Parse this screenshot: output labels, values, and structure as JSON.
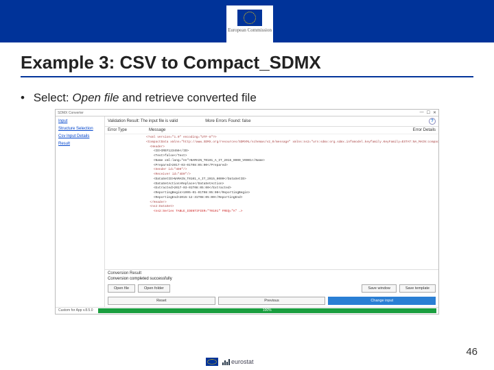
{
  "slide": {
    "title": "Example 3: CSV to Compact_SDMX",
    "bullet_prefix": "Select: ",
    "bullet_italic": "Open file",
    "bullet_rest": " and retrieve converted file",
    "page_number": "46"
  },
  "logo": {
    "top_label": "European\nCommission",
    "footer_text": "eurostat"
  },
  "app": {
    "window_title": "SDMX Converter",
    "win_min": "—",
    "win_max": "☐",
    "win_close": "✕",
    "sidebar": {
      "items": [
        "Input",
        "Structure Selection",
        "Csv Input Details",
        "Result"
      ]
    },
    "validation": {
      "label": "Validation Result:",
      "value": "The input file is valid",
      "errors_label": "More Errors Found:",
      "errors_value": "false",
      "help": "?"
    },
    "columns": {
      "c1": "Error Type",
      "c2": "Message",
      "c3": "Error Details"
    },
    "xml_lines": [
      "<?xml version=\"1.0\" encoding=\"UTF-8\"?>",
      "<CompactData xmlns=\"http://www.SDMX.org/resources/SDMXML/schemas/v2_0/message\" xmlns:ns2=\"urn:sdmx:org.sdmx.infomodel.keyfamily.KeyFamily=ESTAT:NA_MAIN:compact\">",
      "  <Header>",
      "    <ID>IREF123456</ID>",
      "    <Test>false</Test>",
      "    <Name xml:lang=\"en\">NAMAIN_T0101_A_IT_2015_0000_V0001</Name>",
      "    <Prepared>2017-03-01T08:05:00</Prepared>",
      "    <Sender id=\"4D0\"/>",
      "    <Receiver id=\"4D0\"/>",
      "    <DataSetID>NAMAIN_T0101_A_IT_2015_0000</DataSetID>",
      "    <DataSetAction>Replace</DataSetAction>",
      "    <Extracted>2017-03-01T08:05:00</Extracted>",
      "    <ReportingBegin>1995-01-01T08:05:00</ReportingBegin>",
      "    <ReportingEnd>2015-12-31T08:05:00</ReportingEnd>",
      "  </Header>",
      "  <ns2:DataSet>",
      "    <ns2:Series TABLE_IDENTIFIER=\"T0101\" FREQ=\"A\" …>"
    ],
    "conversion": {
      "heading": "Conversion Result",
      "message": "Conversion completed successfully"
    },
    "buttons": {
      "open_file": "Open file",
      "open_folder": "Open folder",
      "save_window": "Save window",
      "save_template": "Save template",
      "reset": "Reset",
      "previous": "Previous",
      "change_input": "Change input"
    },
    "status": {
      "left": "Custom for App v.8.5.0",
      "progress": "100%"
    }
  }
}
